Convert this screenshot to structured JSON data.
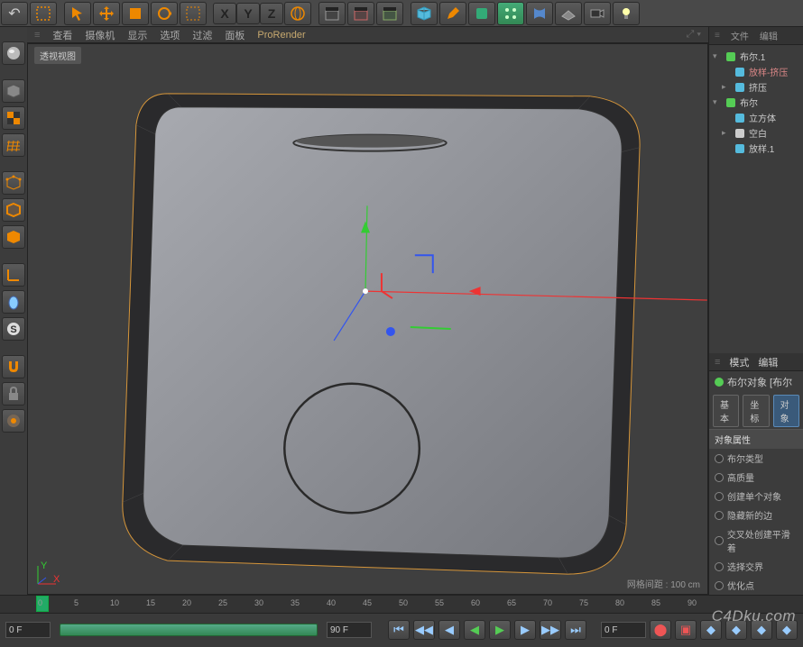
{
  "topbar": {
    "undo": "↶",
    "axis_x": "X",
    "axis_y": "Y",
    "axis_z": "Z"
  },
  "view_menu": {
    "items": [
      "查看",
      "摄像机",
      "显示",
      "选项",
      "过滤",
      "面板"
    ],
    "prorender": "ProRender"
  },
  "view_label": "透视视图",
  "grid_info": "网格间距 : 100 cm",
  "right": {
    "hdr": [
      "文件",
      "编辑"
    ],
    "tree": [
      {
        "lv": 0,
        "toggle": "▾",
        "icon": "boole",
        "label": "布尔.1",
        "sel": false
      },
      {
        "lv": 1,
        "toggle": "",
        "icon": "loft",
        "label": "放样-挤压",
        "sel": true
      },
      {
        "lv": 1,
        "toggle": "▸",
        "icon": "extr",
        "label": "挤压",
        "sel": false
      },
      {
        "lv": 0,
        "toggle": "▾",
        "icon": "boole",
        "label": "布尔",
        "sel": false
      },
      {
        "lv": 1,
        "toggle": "",
        "icon": "cube",
        "label": "立方体",
        "sel": false
      },
      {
        "lv": 1,
        "toggle": "▸",
        "icon": "null",
        "label": "空白",
        "sel": false
      },
      {
        "lv": 1,
        "toggle": "",
        "icon": "loft",
        "label": "放样.1",
        "sel": false
      }
    ],
    "attr_hdr": [
      "模式",
      "编辑"
    ],
    "attr_title": "布尔对象 [布尔",
    "tabs": [
      "基本",
      "坐标",
      "对象"
    ],
    "active_tab": 2,
    "section": "对象属性",
    "rows": [
      "布尔类型",
      "高质量",
      "创建单个对象",
      "隐藏新的边",
      "交叉处创建平滑着",
      "选择交界",
      "优化点"
    ]
  },
  "timeline": {
    "start": "0 F",
    "end": "90 F",
    "cur": "0 F",
    "len": "90 F",
    "ticks": [
      0,
      5,
      10,
      15,
      20,
      25,
      30,
      35,
      40,
      45,
      50,
      55,
      60,
      65,
      70,
      75,
      80,
      85,
      90
    ]
  },
  "watermark": "C4Dku.com"
}
